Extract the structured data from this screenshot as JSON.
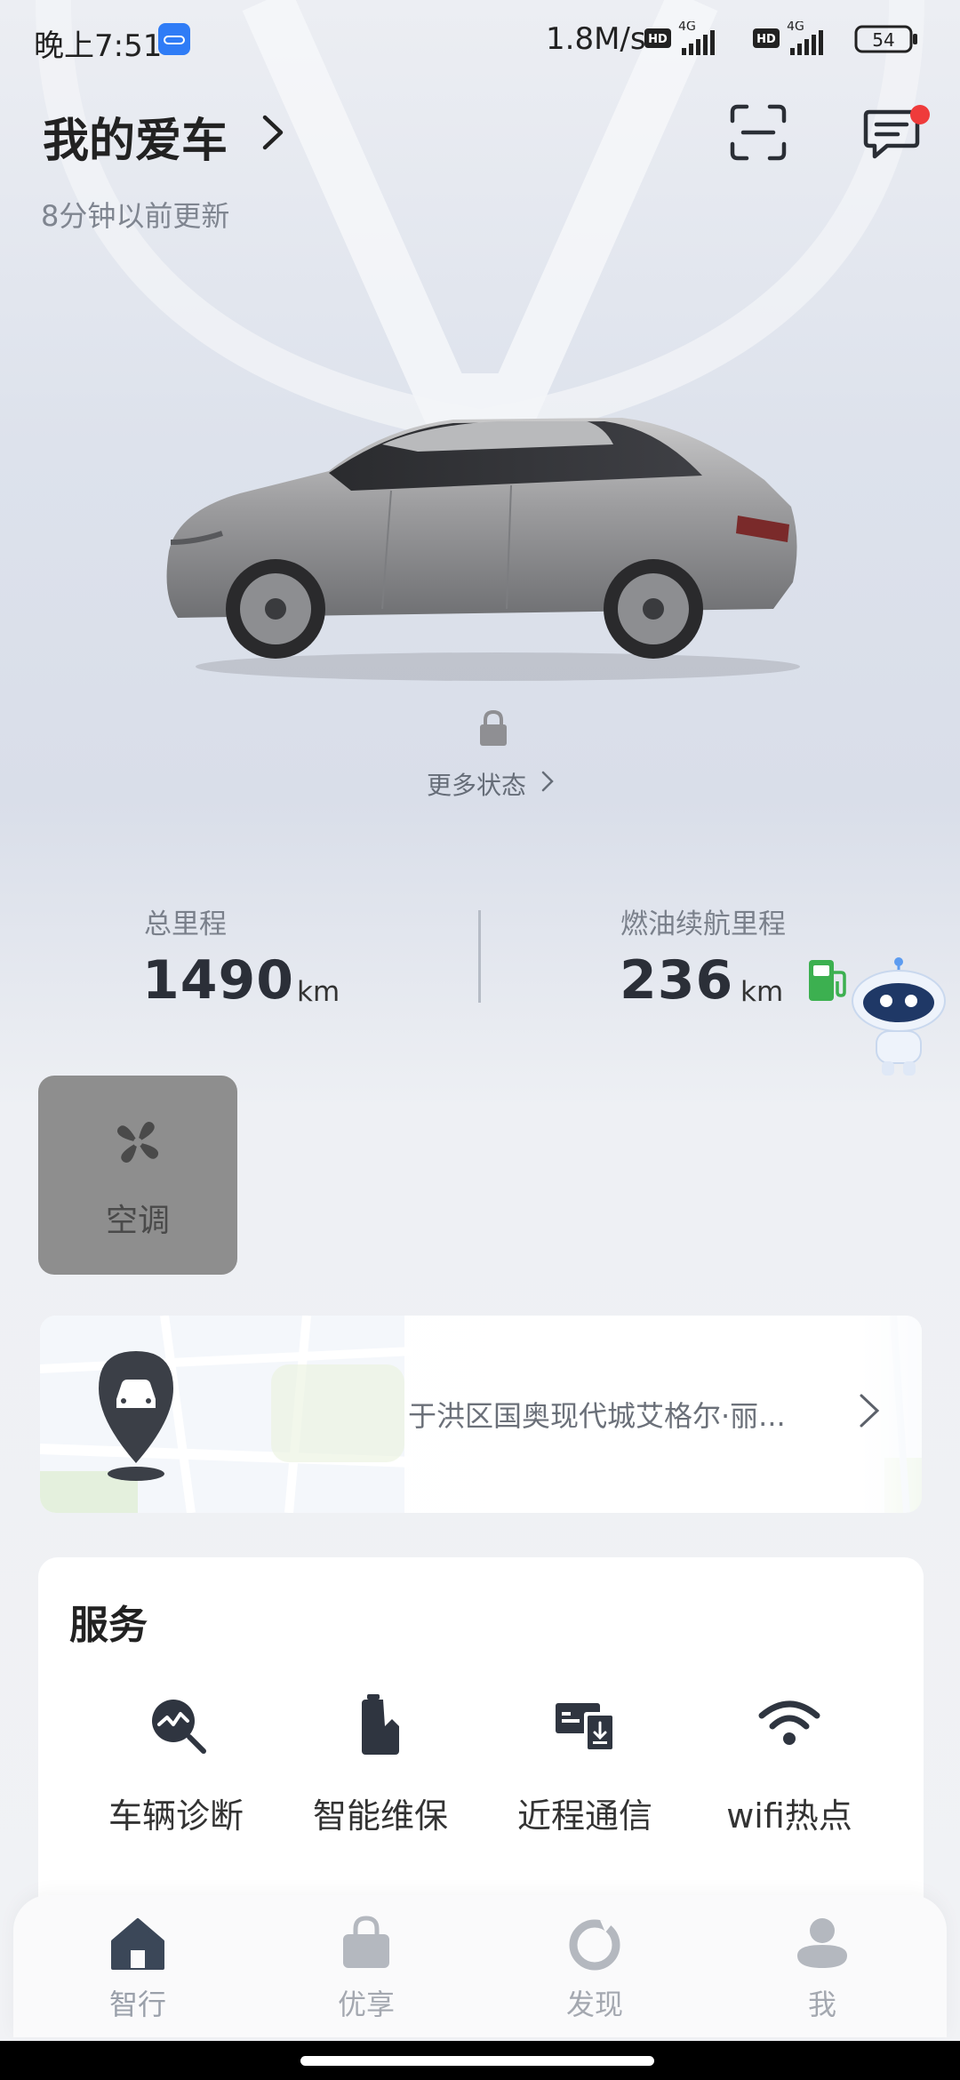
{
  "status_bar": {
    "time": "晚上7:51",
    "net_speed": "1.8M/s",
    "hd1": "HD",
    "net1": "4G",
    "hd2": "HD",
    "net2": "4G",
    "battery": "54"
  },
  "header": {
    "title": "我的爱车",
    "updated": "8分钟以前更新"
  },
  "car": {
    "more_status": "更多状态"
  },
  "stats": {
    "total_mileage_label": "总里程",
    "total_mileage_value": "1490",
    "total_mileage_unit": "km",
    "fuel_range_label": "燃油续航里程",
    "fuel_range_value": "236",
    "fuel_range_unit": "km"
  },
  "quick_controls": {
    "ac_label": "空调"
  },
  "location": {
    "address": "于洪区国奥现代城艾格尔·丽..."
  },
  "services": {
    "title": "服务",
    "items": [
      {
        "label": "车辆诊断",
        "icon": "diagnosis-icon"
      },
      {
        "label": "智能维保",
        "icon": "maintenance-icon"
      },
      {
        "label": "近程通信",
        "icon": "nearfield-comm-icon"
      },
      {
        "label": "wifi热点",
        "icon": "wifi-icon"
      }
    ]
  },
  "bottom_nav": {
    "items": [
      {
        "label": "智行",
        "icon": "home-icon"
      },
      {
        "label": "优享",
        "icon": "bag-icon"
      },
      {
        "label": "发现",
        "icon": "discover-icon"
      },
      {
        "label": "我",
        "icon": "user-icon"
      }
    ]
  },
  "colors": {
    "notification_dot": "#ef3b3b",
    "fuel_green": "#3cb050",
    "ac_tile": "#8e8e8e"
  }
}
